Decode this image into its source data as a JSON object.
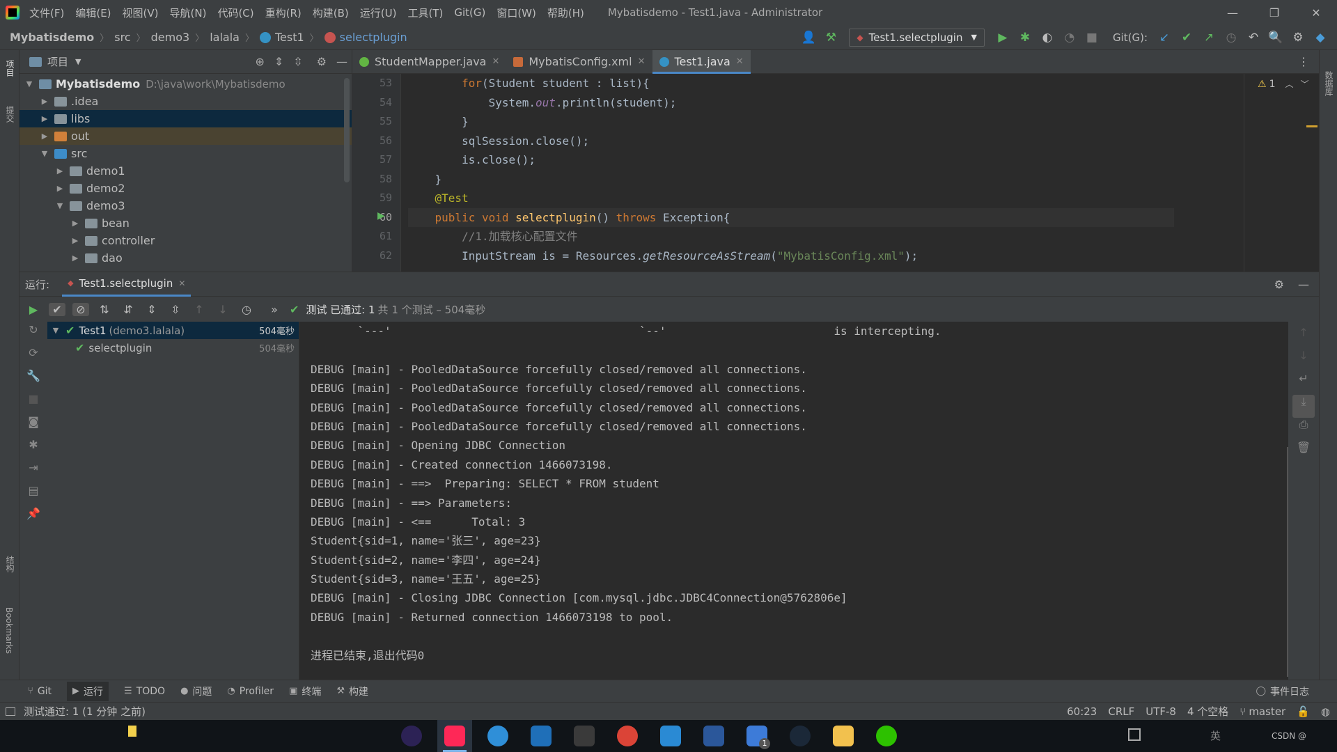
{
  "titlebar": {
    "menu": [
      "文件(F)",
      "编辑(E)",
      "视图(V)",
      "导航(N)",
      "代码(C)",
      "重构(R)",
      "构建(B)",
      "运行(U)",
      "工具(T)",
      "Git(G)",
      "窗口(W)",
      "帮助(H)"
    ],
    "title": "Mybatisdemo - Test1.java - Administrator",
    "controls": [
      "—",
      "❐",
      "✕"
    ]
  },
  "navbar": {
    "crumbs": [
      "Mybatisdemo",
      "src",
      "demo3",
      "lalala",
      "Test1",
      "selectplugin"
    ],
    "run_config": "Test1.selectplugin",
    "git_label": "Git(G):"
  },
  "leftstrip": {
    "project": "项目",
    "commit": "提交",
    "structure": "结构",
    "bookmarks": "Bookmarks"
  },
  "rightstrip": {
    "database": "数据库"
  },
  "project": {
    "title": "项目",
    "root_name": "Mybatisdemo",
    "root_path": "D:\\java\\work\\Mybatisdemo",
    "items": [
      {
        "label": ".idea",
        "depth": 1,
        "expanded": false
      },
      {
        "label": "libs",
        "depth": 1,
        "expanded": false
      },
      {
        "label": "out",
        "depth": 1,
        "expanded": false
      },
      {
        "label": "src",
        "depth": 1,
        "expanded": true
      },
      {
        "label": "demo1",
        "depth": 2,
        "expanded": false
      },
      {
        "label": "demo2",
        "depth": 2,
        "expanded": false
      },
      {
        "label": "demo3",
        "depth": 2,
        "expanded": true
      },
      {
        "label": "bean",
        "depth": 3,
        "expanded": false
      },
      {
        "label": "controller",
        "depth": 3,
        "expanded": false
      },
      {
        "label": "dao",
        "depth": 3,
        "expanded": false
      }
    ]
  },
  "tabs": [
    {
      "label": "StudentMapper.java",
      "active": false,
      "color": "#62b543"
    },
    {
      "label": "MybatisConfig.xml",
      "active": false,
      "color": "#c76a3a"
    },
    {
      "label": "Test1.java",
      "active": true,
      "color": "#3592c4"
    }
  ],
  "editor": {
    "line_numbers": [
      "53",
      "54",
      "55",
      "56",
      "57",
      "58",
      "59",
      "60",
      "61",
      "62"
    ],
    "current_line": "60",
    "warnings": "1",
    "lines": {
      "l53_a": "        ",
      "l53_kw": "for",
      "l53_b": "(Student student : list){",
      "l54_a": "            System.",
      "l54_it": "out",
      "l54_b": ".println(student);",
      "l55": "        }",
      "l56": "        sqlSession.close();",
      "l57": "        is.close();",
      "l58": "    }",
      "l59": "    @Test",
      "l60_kw1": "public void ",
      "l60_fn": "selectplugin",
      "l60_b": "() ",
      "l60_kw2": "throws",
      "l60_c": " Exception{",
      "l61": "        //1.加载核心配置文件",
      "l62_a": "        InputStream is = Resources.",
      "l62_it": "getResourceAsStream",
      "l62_b": "(",
      "l62_st": "\"MybatisConfig.xml\"",
      "l62_c": ");"
    }
  },
  "run": {
    "label": "运行:",
    "tab": "Test1.selectplugin",
    "status_pass": "测试 已通过: 1",
    "status_detail": "共 1 个测试 – 504毫秒",
    "tests": [
      {
        "name": "Test1",
        "suffix": "(demo3.lalala)",
        "time": "504毫秒"
      },
      {
        "name": "selectplugin",
        "suffix": "",
        "time": "504毫秒"
      }
    ],
    "console": [
      "       `---'                                     `--'                         is intercepting.",
      "",
      "DEBUG [main] - PooledDataSource forcefully closed/removed all connections.",
      "DEBUG [main] - PooledDataSource forcefully closed/removed all connections.",
      "DEBUG [main] - PooledDataSource forcefully closed/removed all connections.",
      "DEBUG [main] - PooledDataSource forcefully closed/removed all connections.",
      "DEBUG [main] - Opening JDBC Connection",
      "DEBUG [main] - Created connection 1466073198.",
      "DEBUG [main] - ==>  Preparing: SELECT * FROM student",
      "DEBUG [main] - ==> Parameters: ",
      "DEBUG [main] - <==      Total: 3",
      "Student{sid=1, name='张三', age=23}",
      "Student{sid=2, name='李四', age=24}",
      "Student{sid=3, name='王五', age=25}",
      "DEBUG [main] - Closing JDBC Connection [com.mysql.jdbc.JDBC4Connection@5762806e]",
      "DEBUG [main] - Returned connection 1466073198 to pool.",
      "",
      "进程已结束,退出代码0"
    ]
  },
  "bottom_tools": [
    "Git",
    "运行",
    "TODO",
    "问题",
    "Profiler",
    "终端",
    "构建"
  ],
  "event_log": "事件日志",
  "statusbar": {
    "message": "测试通过: 1 (1 分钟 之前)",
    "position": "60:23",
    "line_sep": "CRLF",
    "encoding": "UTF-8",
    "indent": "4 个空格",
    "branch": "master"
  },
  "taskbar": {
    "apps": [
      {
        "name": "eclipse",
        "color": "#2c2255"
      },
      {
        "name": "intellij",
        "color": "#fe2857"
      },
      {
        "name": "app-blue-green",
        "color": "#2f8fd8"
      },
      {
        "name": "app-orange-blue",
        "color": "#1f6fb8"
      },
      {
        "name": "terminal",
        "color": "#3a3a3a"
      },
      {
        "name": "chrome",
        "color": "#db4437"
      },
      {
        "name": "vscode",
        "color": "#2a8ad4"
      },
      {
        "name": "word",
        "color": "#2b579a"
      },
      {
        "name": "todo",
        "color": "#3d7bd8"
      },
      {
        "name": "steam",
        "color": "#1b2838"
      },
      {
        "name": "file-explorer",
        "color": "#f2c14e"
      },
      {
        "name": "wechat",
        "color": "#2dc100"
      }
    ],
    "todo_badge": "1",
    "ime": "英",
    "watermark": "CSDN @"
  }
}
